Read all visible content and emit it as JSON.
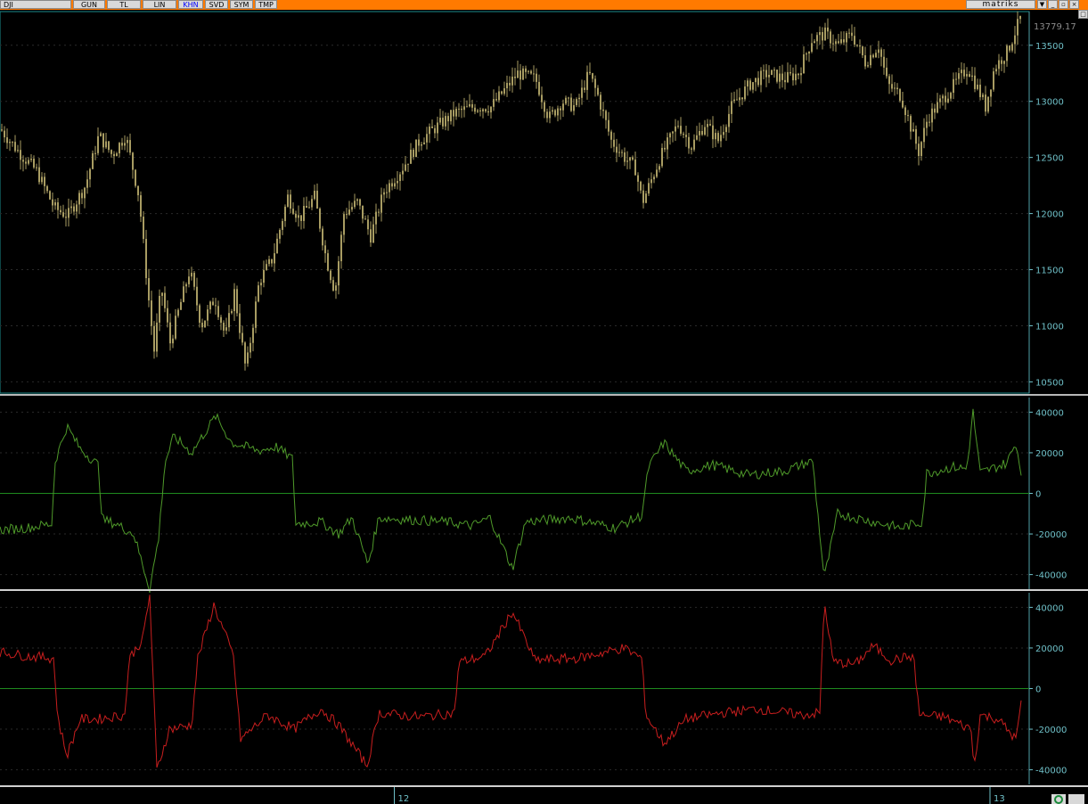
{
  "toolbar": {
    "symbol": "DJI",
    "buttons": [
      {
        "label": "GUN",
        "active": false
      },
      {
        "label": "TL",
        "active": false
      },
      {
        "label": "LIN",
        "active": false
      },
      {
        "label": "KHN",
        "active": true
      },
      {
        "label": "SVD",
        "active": false
      },
      {
        "label": "SYM",
        "active": false
      },
      {
        "label": "TMP",
        "active": false
      }
    ],
    "brand": "matriks",
    "window_icons": [
      "dropdown-icon",
      "minimize-icon",
      "restore-icon",
      "close-icon"
    ]
  },
  "colors": {
    "toolbar_bg": "#ff7a00",
    "price": "#a89c62",
    "indicator1": "#4f9a2a",
    "indicator2": "#c81e1e",
    "zero_line": "#1e8a1e",
    "axis": "#6fc0c8",
    "separator": "#b8b8b8"
  },
  "chart_data": [
    {
      "type": "candlestick",
      "last_value_label": "13779.17",
      "ylim": [
        10400,
        13800
      ],
      "y_ticks": [
        10500,
        11000,
        11500,
        12000,
        12500,
        13000,
        13500
      ],
      "close_path": [
        [
          0,
          12750
        ],
        [
          20,
          12550
        ],
        [
          40,
          12380
        ],
        [
          60,
          12050
        ],
        [
          75,
          11980
        ],
        [
          95,
          12250
        ],
        [
          110,
          12700
        ],
        [
          125,
          12520
        ],
        [
          140,
          12700
        ],
        [
          155,
          12150
        ],
        [
          165,
          11300
        ],
        [
          172,
          10780
        ],
        [
          180,
          11350
        ],
        [
          190,
          10850
        ],
        [
          200,
          11150
        ],
        [
          212,
          11500
        ],
        [
          225,
          11000
        ],
        [
          240,
          11250
        ],
        [
          252,
          10900
        ],
        [
          262,
          11300
        ],
        [
          275,
          10600
        ],
        [
          290,
          11400
        ],
        [
          305,
          11600
        ],
        [
          322,
          12150
        ],
        [
          335,
          11950
        ],
        [
          352,
          12150
        ],
        [
          365,
          11600
        ],
        [
          375,
          11300
        ],
        [
          385,
          12000
        ],
        [
          400,
          12100
        ],
        [
          415,
          11800
        ],
        [
          430,
          12200
        ],
        [
          450,
          12400
        ],
        [
          470,
          12650
        ],
        [
          490,
          12780
        ],
        [
          510,
          12900
        ],
        [
          530,
          12950
        ],
        [
          550,
          12950
        ],
        [
          565,
          13100
        ],
        [
          580,
          13250
        ],
        [
          600,
          13200
        ],
        [
          615,
          12850
        ],
        [
          630,
          13000
        ],
        [
          645,
          12950
        ],
        [
          660,
          13250
        ],
        [
          670,
          13050
        ],
        [
          685,
          12650
        ],
        [
          700,
          12500
        ],
        [
          712,
          12400
        ],
        [
          720,
          12100
        ],
        [
          740,
          12500
        ],
        [
          760,
          12800
        ],
        [
          775,
          12600
        ],
        [
          790,
          12800
        ],
        [
          805,
          12650
        ],
        [
          820,
          12950
        ],
        [
          840,
          13150
        ],
        [
          860,
          13250
        ],
        [
          880,
          13200
        ],
        [
          895,
          13250
        ],
        [
          910,
          13550
        ],
        [
          925,
          13600
        ],
        [
          940,
          13500
        ],
        [
          955,
          13600
        ],
        [
          970,
          13350
        ],
        [
          985,
          13500
        ],
        [
          995,
          13150
        ],
        [
          1010,
          13050
        ],
        [
          1020,
          12800
        ],
        [
          1030,
          12550
        ],
        [
          1040,
          12850
        ],
        [
          1055,
          13000
        ],
        [
          1070,
          13150
        ],
        [
          1085,
          13300
        ],
        [
          1100,
          13050
        ],
        [
          1105,
          12950
        ],
        [
          1115,
          13300
        ],
        [
          1130,
          13450
        ],
        [
          1146,
          13779
        ]
      ]
    },
    {
      "type": "line",
      "ylim": [
        -45000,
        45000
      ],
      "y_ticks": [
        40000,
        20000,
        0,
        -20000,
        -40000
      ],
      "values": [
        [
          0,
          -18000
        ],
        [
          30,
          -17000
        ],
        [
          58,
          -15000
        ],
        [
          62,
          16000
        ],
        [
          75,
          33000
        ],
        [
          90,
          22000
        ],
        [
          110,
          14000
        ],
        [
          115,
          -13000
        ],
        [
          130,
          -15000
        ],
        [
          150,
          -20000
        ],
        [
          168,
          -47000
        ],
        [
          178,
          -22000
        ],
        [
          185,
          15000
        ],
        [
          195,
          28000
        ],
        [
          215,
          20000
        ],
        [
          242,
          38000
        ],
        [
          260,
          25000
        ],
        [
          290,
          21000
        ],
        [
          310,
          23000
        ],
        [
          328,
          17000
        ],
        [
          332,
          -15000
        ],
        [
          360,
          -14000
        ],
        [
          380,
          -20000
        ],
        [
          395,
          -12000
        ],
        [
          413,
          -35000
        ],
        [
          425,
          -12000
        ],
        [
          460,
          -13000
        ],
        [
          500,
          -14000
        ],
        [
          530,
          -16000
        ],
        [
          550,
          -12000
        ],
        [
          575,
          -37000
        ],
        [
          590,
          -14000
        ],
        [
          640,
          -12000
        ],
        [
          690,
          -17000
        ],
        [
          720,
          -11000
        ],
        [
          728,
          13000
        ],
        [
          745,
          25000
        ],
        [
          770,
          11000
        ],
        [
          800,
          14000
        ],
        [
          840,
          9000
        ],
        [
          880,
          11000
        ],
        [
          912,
          16000
        ],
        [
          918,
          -11000
        ],
        [
          925,
          -42000
        ],
        [
          940,
          -10000
        ],
        [
          980,
          -14000
        ],
        [
          1010,
          -17000
        ],
        [
          1035,
          -14000
        ],
        [
          1040,
          10000
        ],
        [
          1070,
          13000
        ],
        [
          1085,
          12000
        ],
        [
          1092,
          40000
        ],
        [
          1100,
          10000
        ],
        [
          1130,
          15000
        ],
        [
          1140,
          25000
        ],
        [
          1146,
          10000
        ]
      ]
    },
    {
      "type": "line",
      "ylim": [
        -45000,
        45000
      ],
      "y_ticks": [
        40000,
        20000,
        0,
        -20000,
        -40000
      ],
      "values": [
        [
          0,
          18000
        ],
        [
          30,
          16000
        ],
        [
          60,
          15000
        ],
        [
          65,
          -15000
        ],
        [
          75,
          -33000
        ],
        [
          90,
          -15000
        ],
        [
          110,
          -15000
        ],
        [
          140,
          -13000
        ],
        [
          145,
          15000
        ],
        [
          160,
          24000
        ],
        [
          168,
          46000
        ],
        [
          176,
          -40000
        ],
        [
          190,
          -20000
        ],
        [
          215,
          -18000
        ],
        [
          222,
          15000
        ],
        [
          240,
          41000
        ],
        [
          262,
          16000
        ],
        [
          270,
          -25000
        ],
        [
          300,
          -13000
        ],
        [
          330,
          -20000
        ],
        [
          360,
          -10000
        ],
        [
          380,
          -18000
        ],
        [
          412,
          -38000
        ],
        [
          425,
          -12000
        ],
        [
          470,
          -14000
        ],
        [
          510,
          -12000
        ],
        [
          515,
          13000
        ],
        [
          545,
          16000
        ],
        [
          575,
          38000
        ],
        [
          600,
          14000
        ],
        [
          650,
          15000
        ],
        [
          700,
          20000
        ],
        [
          720,
          15000
        ],
        [
          725,
          -13000
        ],
        [
          745,
          -27000
        ],
        [
          770,
          -15000
        ],
        [
          810,
          -12000
        ],
        [
          850,
          -10000
        ],
        [
          900,
          -13000
        ],
        [
          920,
          -12000
        ],
        [
          925,
          43000
        ],
        [
          935,
          13000
        ],
        [
          960,
          12000
        ],
        [
          980,
          21000
        ],
        [
          1000,
          14000
        ],
        [
          1025,
          16000
        ],
        [
          1032,
          -13000
        ],
        [
          1060,
          -14000
        ],
        [
          1090,
          -20000
        ],
        [
          1093,
          -40000
        ],
        [
          1100,
          -13000
        ],
        [
          1120,
          -15000
        ],
        [
          1140,
          -25000
        ],
        [
          1146,
          -8000
        ]
      ]
    }
  ],
  "time_axis": {
    "labels": [
      {
        "label": "12",
        "x": 0.3624
      },
      {
        "label": "13",
        "x": 0.9099
      }
    ]
  }
}
